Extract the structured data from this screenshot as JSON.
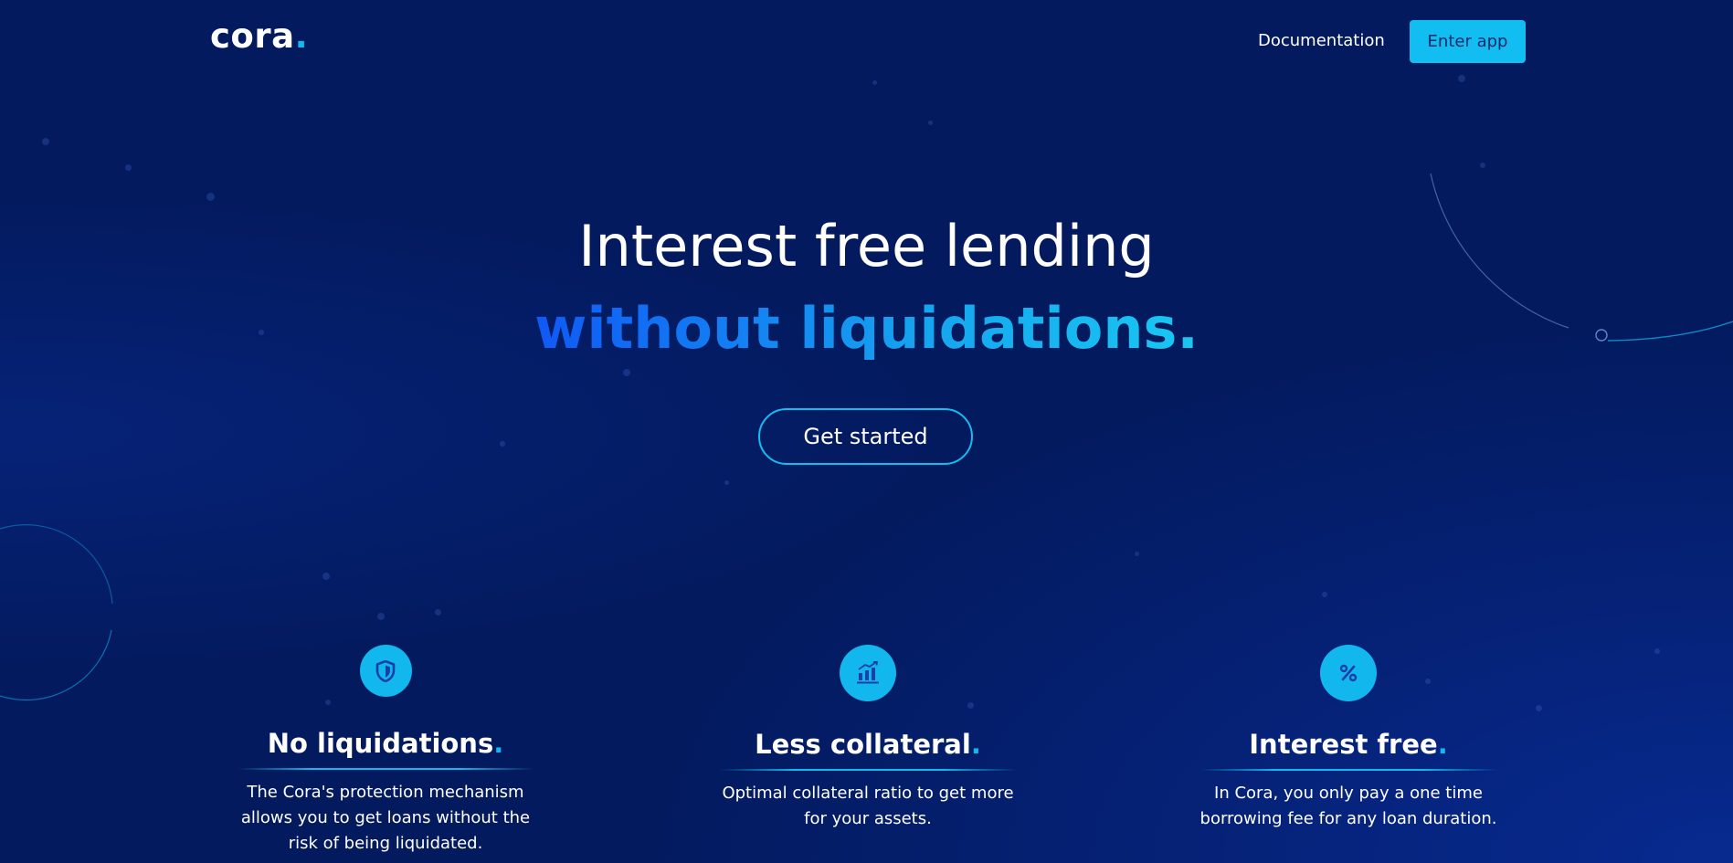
{
  "header": {
    "logo_text": "cora",
    "logo_dot": ".",
    "nav_documentation": "Documentation",
    "enter_app": "Enter app"
  },
  "hero": {
    "line1": "Interest free lending",
    "line2": "without liquidations.",
    "cta": "Get started"
  },
  "features": [
    {
      "icon": "shield-icon",
      "title": "No liquidations",
      "dot": ".",
      "description": "The Cora's protection mechanism allows you to get loans without the risk of being liquidated."
    },
    {
      "icon": "bar-chart-icon",
      "title": "Less collateral",
      "dot": ".",
      "description": "Optimal collateral ratio to get more for your assets."
    },
    {
      "icon": "percent-icon",
      "title": "Interest free",
      "dot": ".",
      "description": "In Cora, you only pay a one time borrowing fee for any loan duration."
    }
  ],
  "colors": {
    "background": "#031a5e",
    "accent": "#12b9f0",
    "gradient_start": "#1059f5"
  }
}
